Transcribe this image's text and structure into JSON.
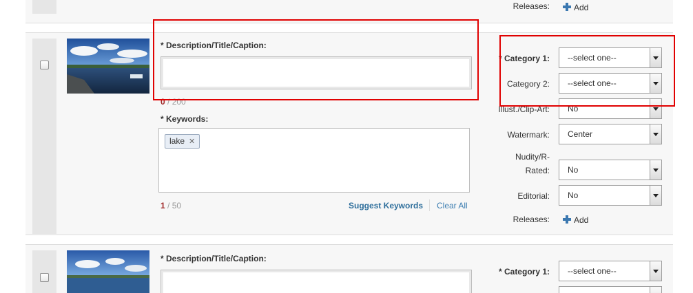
{
  "top_row": {
    "releases_label": "Releases:",
    "add_label": "Add"
  },
  "items": [
    {
      "description_label": "* Description/Title/Caption:",
      "description_value": "",
      "description_counter": {
        "current": "0",
        "max": " / 200"
      },
      "keywords_label": "* Keywords:",
      "keywords": [
        "lake"
      ],
      "keywords_counter": {
        "current": "1",
        "max": " / 50"
      },
      "suggest_keywords": "Suggest Keywords",
      "clear_all": "Clear All",
      "fields": {
        "category1": {
          "label": "* Category 1:",
          "value": "--select one--"
        },
        "category2": {
          "label": "Category 2:",
          "value": "--select one--"
        },
        "illust": {
          "label": "Illust./Clip-Art:",
          "value": "No"
        },
        "watermark": {
          "label": "Watermark:",
          "value": "Center"
        },
        "nudity": {
          "label_line1": "Nudity/R-",
          "label_line2": "Rated:",
          "value": "No"
        },
        "editorial": {
          "label": "Editorial:",
          "value": "No"
        }
      },
      "releases_label": "Releases:",
      "add_label": "Add"
    },
    {
      "description_label": "* Description/Title/Caption:",
      "fields": {
        "category1": {
          "label": "* Category 1:",
          "value": "--select one--"
        }
      }
    }
  ],
  "colors": {
    "highlight": "#e00000",
    "link": "#3a7cb0",
    "counter_current": "#a12b2b"
  }
}
